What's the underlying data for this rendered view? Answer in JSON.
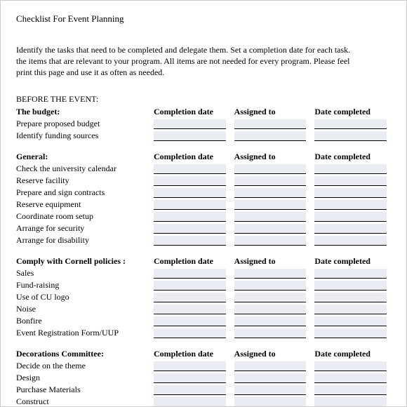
{
  "title": "Checklist For Event Planning",
  "intro": "Identify the tasks that need to be completed and delegate them. Set a completion date for each task.\nthe items that are relevant to your program. All items are not needed for every program. Please feel\nprint this page and use it as often as needed.",
  "before_label": "BEFORE THE EVENT:",
  "columns": {
    "completion": "Completion date",
    "assigned": "Assigned to",
    "completed": "Date completed"
  },
  "sections": [
    {
      "heading": "The budget:",
      "items": [
        "Prepare proposed budget",
        "Identify funding sources"
      ]
    },
    {
      "heading": "General:",
      "items": [
        "Check the university calendar",
        "Reserve facility",
        "Prepare and sign contracts",
        "Reserve equipment",
        "Coordinate room setup",
        "Arrange for security",
        "Arrange for disability"
      ]
    },
    {
      "heading": "Comply with Cornell policies :",
      "items": [
        "Sales",
        "Fund-raising",
        "Use of CU logo",
        "Noise",
        "Bonfire",
        "Event Registration Form/UUP"
      ]
    },
    {
      "heading": "Decorations Committee:",
      "items": [
        "Decide on the theme",
        "Design",
        "Purchase Materials",
        "Construct"
      ]
    }
  ]
}
